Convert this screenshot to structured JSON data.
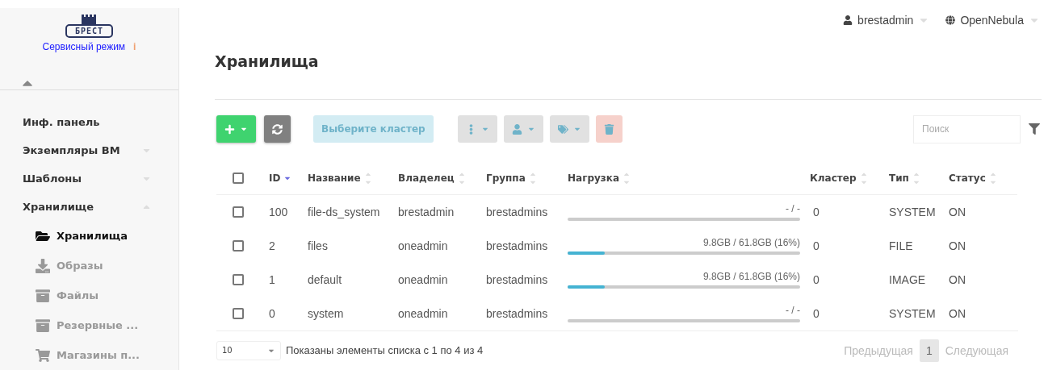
{
  "logo": {
    "text": "БРЕСТ",
    "mode": "Сервисный режим",
    "info": "i"
  },
  "sidebar": {
    "collapsed": false,
    "items": [
      {
        "label": "Инф. панель",
        "has_children": false
      },
      {
        "label": "Экземпляры ВМ",
        "expanded": false,
        "has_children": true
      },
      {
        "label": "Шаблоны",
        "expanded": false,
        "has_children": true
      },
      {
        "label": "Хранилище",
        "expanded": true,
        "has_children": true,
        "children": [
          {
            "label": "Хранилища",
            "selected": true
          },
          {
            "label": "Образы",
            "selected": false
          },
          {
            "label": "Файлы",
            "selected": false
          },
          {
            "label": "Резервные ...",
            "selected": false
          },
          {
            "label": "Магазины п...",
            "selected": false
          }
        ]
      }
    ]
  },
  "header": {
    "user": "brestadmin",
    "zone": "OpenNebula"
  },
  "page_title": "Хранилища",
  "toolbar": {
    "buttons": [
      {
        "kind": "create",
        "disabled": false
      },
      {
        "kind": "refresh",
        "disabled": false
      },
      {
        "kind": "cluster",
        "label": "Выберите кластер",
        "disabled": true
      },
      {
        "kind": "more",
        "disabled": true
      },
      {
        "kind": "user",
        "disabled": true
      },
      {
        "kind": "tag",
        "disabled": true
      },
      {
        "kind": "delete",
        "disabled": true
      }
    ],
    "search": {
      "placeholder": "Поиск"
    }
  },
  "table": {
    "select_all": {
      "checked": false
    },
    "columns": [
      {
        "label": "ID",
        "sorted": true
      },
      {
        "label": "Название",
        "sorted": false
      },
      {
        "label": "Владелец",
        "sorted": false
      },
      {
        "label": "Группа",
        "sorted": false
      },
      {
        "label": "Нагрузка",
        "sorted": false
      },
      {
        "label": "Кластер",
        "sorted": false
      },
      {
        "label": "Тип",
        "sorted": false
      },
      {
        "label": "Статус",
        "sorted": false
      }
    ],
    "rows": [
      {
        "checked": false,
        "id": "100",
        "name": "file-ds_system",
        "owner": "brestadmin",
        "group": "brestadmins",
        "usage": "- / -",
        "cluster": "0",
        "type": "SYSTEM",
        "status": "ON"
      },
      {
        "checked": false,
        "id": "2",
        "name": "files",
        "owner": "oneadmin",
        "group": "brestadmins",
        "usage": "9.8GB / 61.8GB (16%)",
        "level": 0.16,
        "cluster": "0",
        "type": "FILE",
        "status": "ON"
      },
      {
        "checked": false,
        "id": "1",
        "name": "default",
        "owner": "oneadmin",
        "group": "brestadmins",
        "usage": "9.8GB / 61.8GB (16%)",
        "level": 0.16,
        "cluster": "0",
        "type": "IMAGE",
        "status": "ON"
      },
      {
        "checked": false,
        "id": "0",
        "name": "system",
        "owner": "oneadmin",
        "group": "brestadmins",
        "usage": "- / -",
        "cluster": "0",
        "type": "SYSTEM",
        "status": "ON"
      }
    ]
  },
  "footer": {
    "page_size": "10",
    "info": "Показаны элементы списка с 1 по 4 из 4",
    "pages": [
      {
        "label": "Предыдущая",
        "kind": "prev",
        "disabled": true
      },
      {
        "label": "1",
        "kind": "page",
        "selected": true
      },
      {
        "label": "Следующая",
        "kind": "next",
        "disabled": true
      }
    ]
  }
}
